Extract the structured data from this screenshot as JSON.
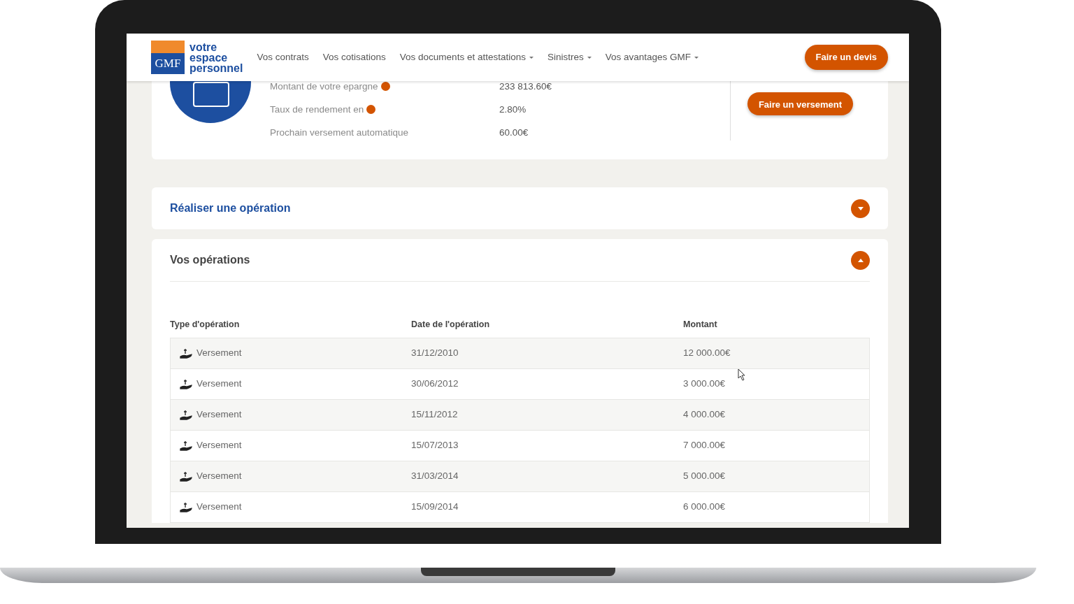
{
  "header": {
    "logo": {
      "brand": "GMF",
      "tagline": [
        "votre",
        "espace",
        "personnel"
      ]
    },
    "nav": [
      {
        "label": "Vos contrats",
        "has_dropdown": false
      },
      {
        "label": "Vos cotisations",
        "has_dropdown": false
      },
      {
        "label": "Vos documents et attestations",
        "has_dropdown": true
      },
      {
        "label": "Sinistres",
        "has_dropdown": true
      },
      {
        "label": "Vos avantages GMF",
        "has_dropdown": true
      }
    ],
    "cta": "Faire un devis"
  },
  "summary": {
    "rows": [
      {
        "label": "Montant de votre epargne",
        "info": true,
        "value": "233 813.60€"
      },
      {
        "label": "Taux de rendement en",
        "info": true,
        "value": "2.80%"
      },
      {
        "label": "Prochain versement automatique",
        "info": false,
        "value": "60.00€"
      }
    ],
    "button": "Faire un versement"
  },
  "sections": [
    {
      "title": "Réaliser une opération",
      "expanded": false
    },
    {
      "title": "Vos opérations",
      "expanded": true
    }
  ],
  "table": {
    "columns": [
      "Type d'opération",
      "Date de l'opération",
      "Montant"
    ],
    "rows": [
      [
        "Versement",
        "31/12/2010",
        "12 000.00€"
      ],
      [
        "Versement",
        "30/06/2012",
        "3 000.00€"
      ],
      [
        "Versement",
        "15/11/2012",
        "4 000.00€"
      ],
      [
        "Versement",
        "15/07/2013",
        "7 000.00€"
      ],
      [
        "Versement",
        "31/03/2014",
        "5 000.00€"
      ],
      [
        "Versement",
        "15/09/2014",
        "6 000.00€"
      ]
    ]
  }
}
